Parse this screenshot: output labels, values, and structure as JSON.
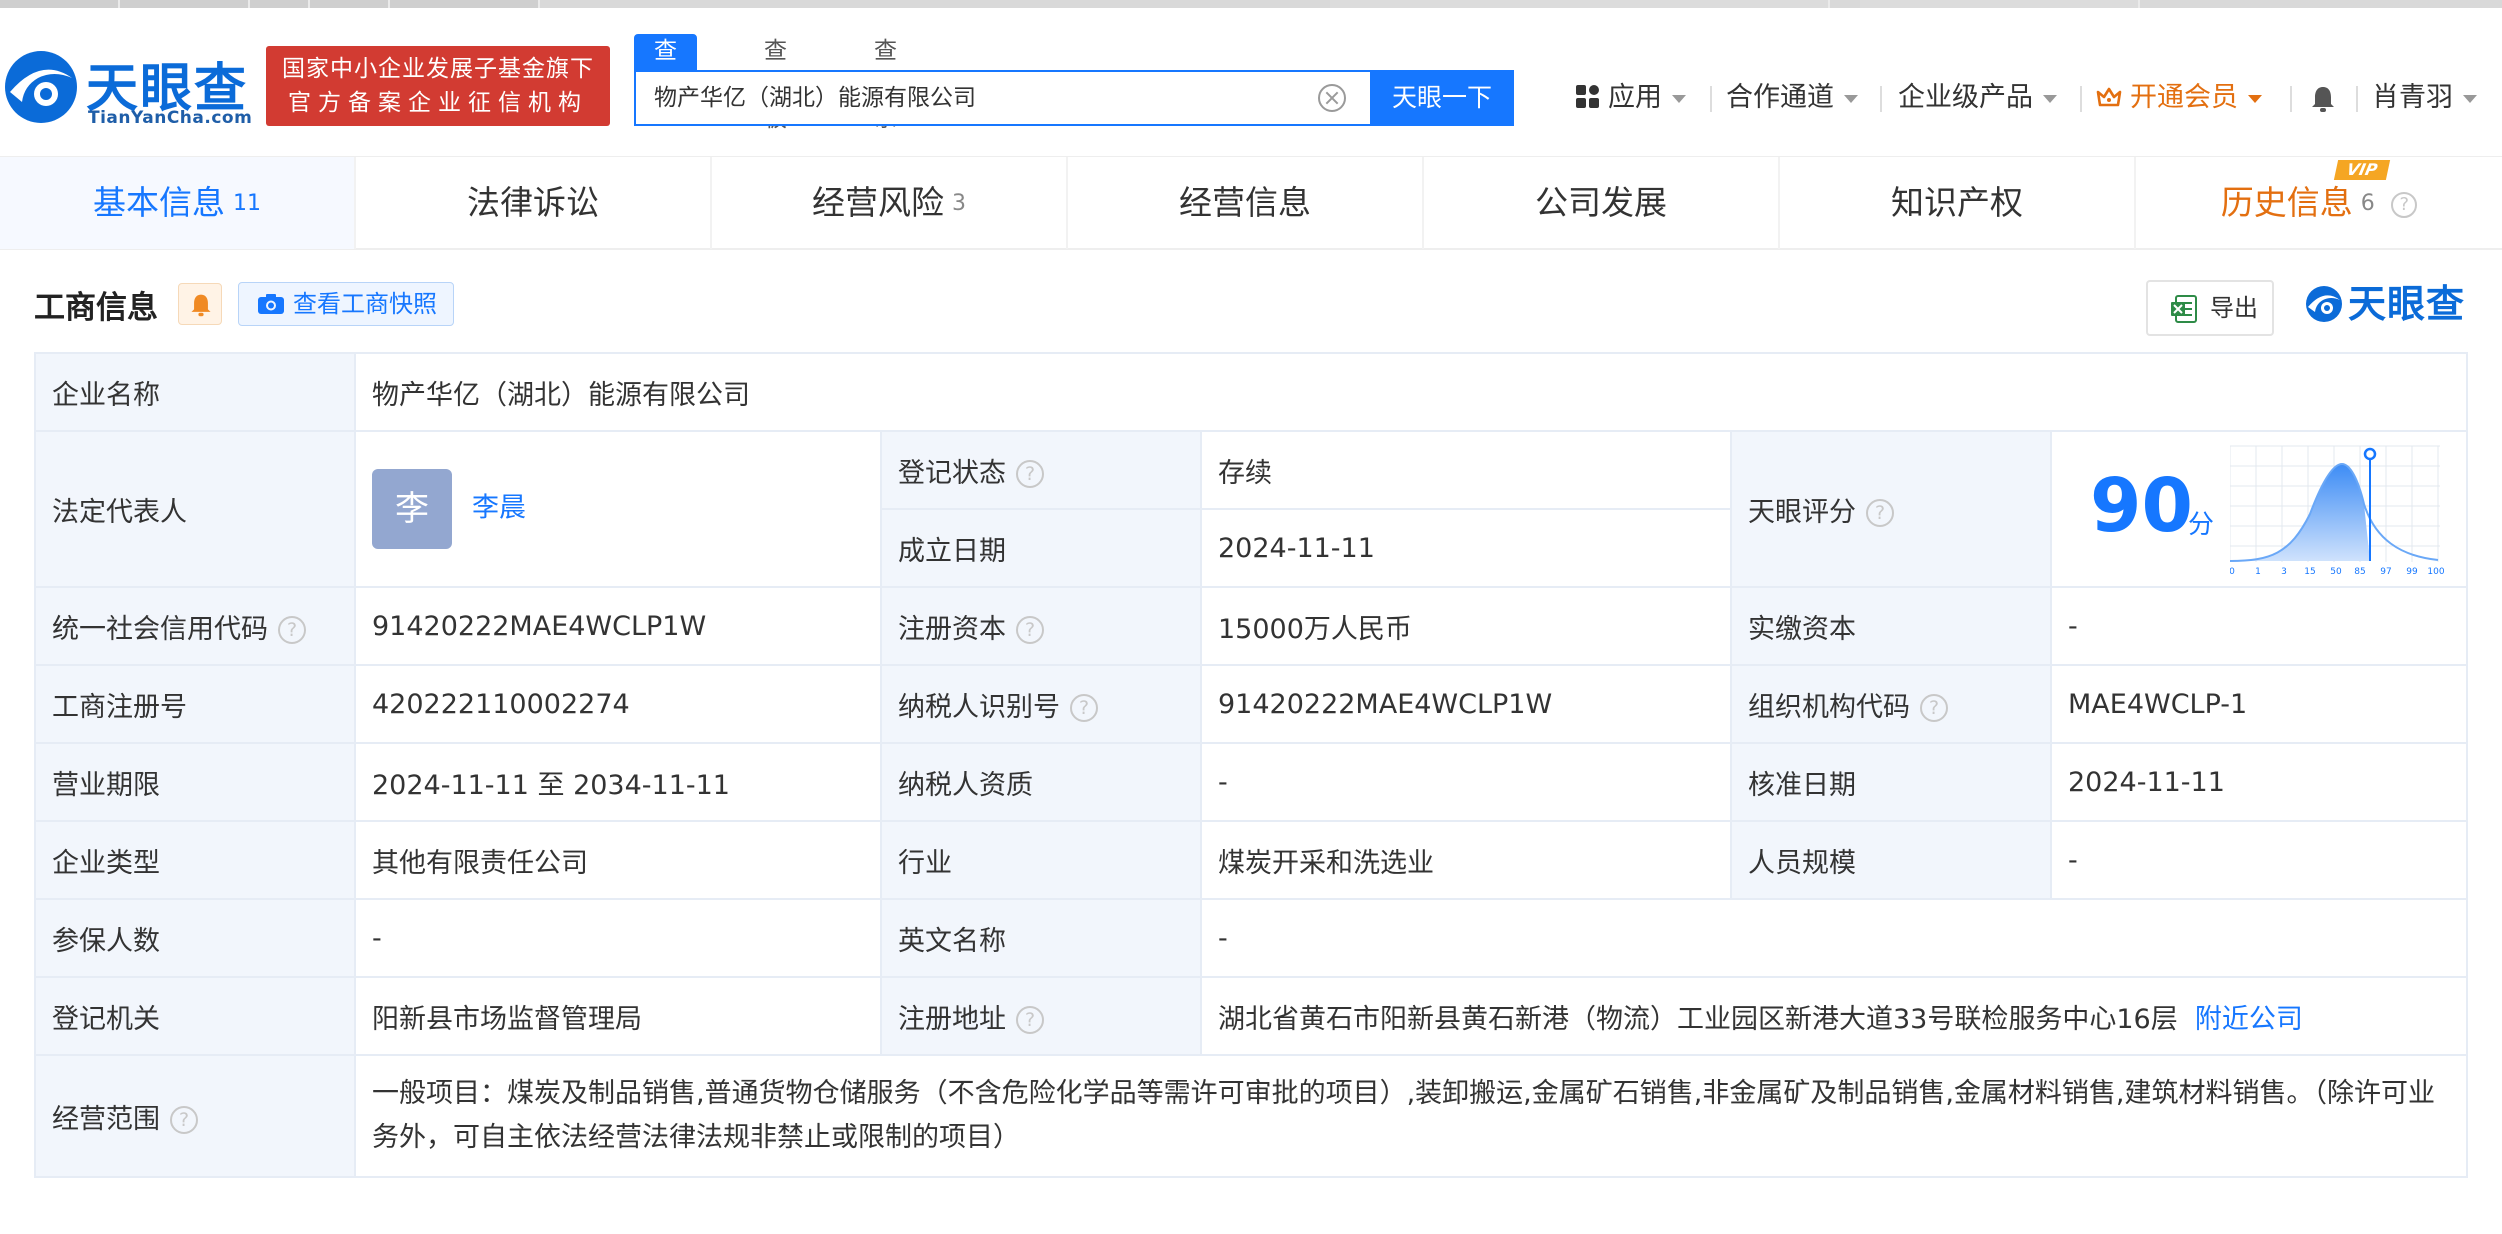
{
  "brand": {
    "logo_cn": "天眼查",
    "logo_en": "TianYanCha.com",
    "badge_line1": "国家中小企业发展子基金旗下",
    "badge_line2": "官方备案企业征信机构",
    "color_primary": "#1677ff",
    "color_badge": "#d23b32"
  },
  "search": {
    "tabs": [
      "查公司",
      "查老板",
      "查关系"
    ],
    "active_tab": "查公司",
    "value": "物产华亿（湖北）能源有限公司",
    "button": "天眼一下"
  },
  "topnav": {
    "apps": "应用",
    "channels": "合作通道",
    "enterprise": "企业级产品",
    "vip": "开通会员",
    "user": "肖青羽"
  },
  "main_tabs": [
    {
      "label": "基本信息",
      "count": "11"
    },
    {
      "label": "法律诉讼",
      "count": ""
    },
    {
      "label": "经营风险",
      "count": "3"
    },
    {
      "label": "经营信息",
      "count": ""
    },
    {
      "label": "公司发展",
      "count": ""
    },
    {
      "label": "知识产权",
      "count": ""
    },
    {
      "label": "历史信息",
      "count": "6"
    }
  ],
  "vip_tag": "VIP",
  "section": {
    "title": "工商信息",
    "snapshot": "查看工商快照",
    "export": "导出",
    "brand_text": "天眼查"
  },
  "info": {
    "company_name_label": "企业名称",
    "company_name": "物产华亿（湖北）能源有限公司",
    "legal_rep_label": "法定代表人",
    "legal_rep_avatar": "李",
    "legal_rep": "李晨",
    "status_label": "登记状态",
    "status": "存续",
    "founded_label": "成立日期",
    "founded": "2024-11-11",
    "score_label": "天眼评分",
    "score": "90",
    "score_unit": "分",
    "score_axis": [
      "0",
      "1",
      "3",
      "15",
      "50",
      "85",
      "97",
      "99",
      "100"
    ],
    "credit_code_label": "统一社会信用代码",
    "credit_code": "91420222MAE4WCLP1W",
    "reg_capital_label": "注册资本",
    "reg_capital": "15000万人民币",
    "paid_capital_label": "实缴资本",
    "paid_capital": "-",
    "reg_no_label": "工商注册号",
    "reg_no": "420222110002274",
    "taxpayer_id_label": "纳税人识别号",
    "taxpayer_id": "91420222MAE4WCLP1W",
    "org_code_label": "组织机构代码",
    "org_code": "MAE4WCLP-1",
    "term_label": "营业期限",
    "term": "2024-11-11 至 2034-11-11",
    "tax_qual_label": "纳税人资质",
    "tax_qual": "-",
    "approved_label": "核准日期",
    "approved": "2024-11-11",
    "type_label": "企业类型",
    "type": "其他有限责任公司",
    "industry_label": "行业",
    "industry": "煤炭开采和洗选业",
    "staff_label": "人员规模",
    "staff": "-",
    "insured_label": "参保人数",
    "insured": "-",
    "en_name_label": "英文名称",
    "en_name": "-",
    "authority_label": "登记机关",
    "authority": "阳新县市场监督管理局",
    "address_label": "注册地址",
    "address": "湖北省黄石市阳新县黄石新港（物流）工业园区新港大道33号联检服务中心16层",
    "nearby": "附近公司",
    "scope_label": "经营范围",
    "scope": "一般项目：煤炭及制品销售,普通货物仓储服务（不含危险化学品等需许可审批的项目）,装卸搬运,金属矿石销售,非金属矿及制品销售,金属材料销售,建筑材料销售。（除许可业务外，可自主依法经营法律法规非禁止或限制的项目）"
  }
}
